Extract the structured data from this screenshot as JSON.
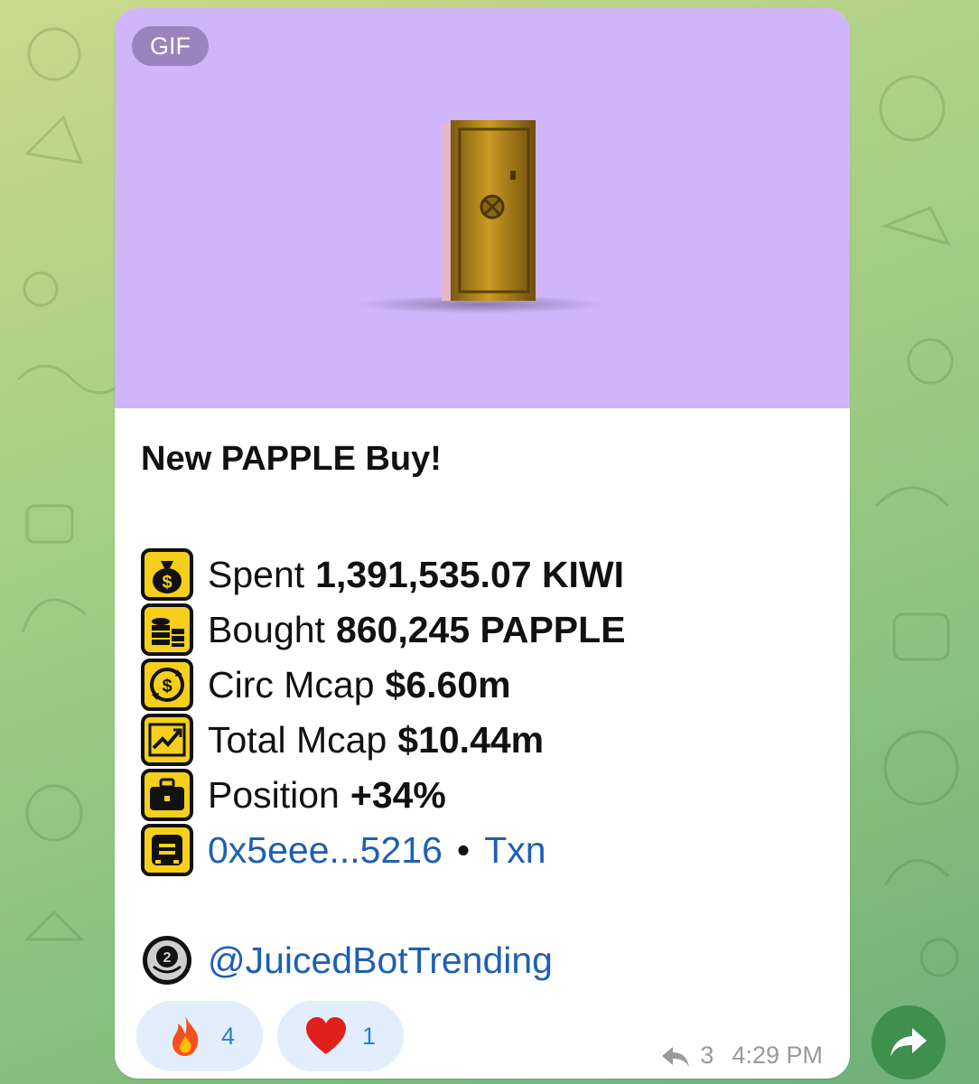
{
  "media": {
    "badge": "GIF",
    "background": "#d0b5fb"
  },
  "message": {
    "title": "New PAPPLE Buy!",
    "rows": [
      {
        "icon": "money-bag-icon",
        "label": "Spent",
        "value": "1,391,535.07 KIWI"
      },
      {
        "icon": "coins-stack-icon",
        "label": "Bought",
        "value": "860,245 PAPPLE"
      },
      {
        "icon": "currency-exchange-icon",
        "label": "Circ Mcap",
        "value": "$6.60m"
      },
      {
        "icon": "chart-up-icon",
        "label": "Total Mcap",
        "value": "$10.44m"
      },
      {
        "icon": "briefcase-icon",
        "label": "Position",
        "value": "+34%"
      }
    ],
    "wallet": {
      "icon": "wallet-icon",
      "address": "0x5eee...5216",
      "separator": "•",
      "txn": "Txn"
    },
    "channel": {
      "icon": "second-place-medal-icon",
      "handle": "@JuicedBotTrending"
    }
  },
  "reactions": [
    {
      "emoji": "fire-icon",
      "count": "4"
    },
    {
      "emoji": "heart-icon",
      "count": "1"
    }
  ],
  "meta": {
    "forwards": "3",
    "time": "4:29 PM"
  },
  "colors": {
    "accent_link": "#1e5fb3",
    "reaction_bg": "#e2eefb",
    "reaction_count": "#2a7cd0",
    "share_button": "#3f8f4d",
    "icon_yellow": "#f5cf1c"
  }
}
